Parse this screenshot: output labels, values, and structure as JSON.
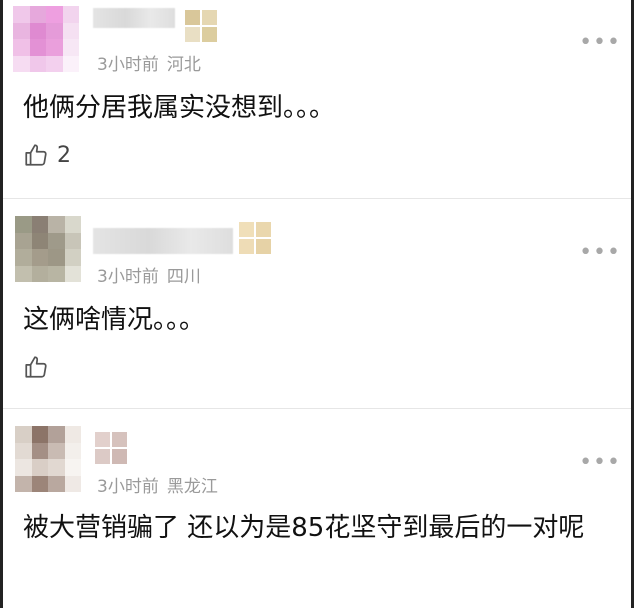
{
  "comments": [
    {
      "time": "3小时前",
      "location": "河北",
      "text": "他俩分居我属实没想到。。。",
      "likes": "2",
      "more": "•••"
    },
    {
      "time": "3小时前",
      "location": "四川",
      "text": "这俩啥情况。。。",
      "likes": "",
      "more": "•••"
    },
    {
      "time": "3小时前",
      "location": "黑龙江",
      "text": "被大营销骗了 还以为是85花坚守到最后的一对呢",
      "likes": "",
      "more": "•••"
    }
  ],
  "colors": {
    "meta": "#9a9a9a",
    "divider": "#e6e6e6",
    "text": "#111111",
    "border": "#222222"
  },
  "icons": {
    "like": "thumbs-up-icon",
    "more": "more-dots-icon"
  }
}
